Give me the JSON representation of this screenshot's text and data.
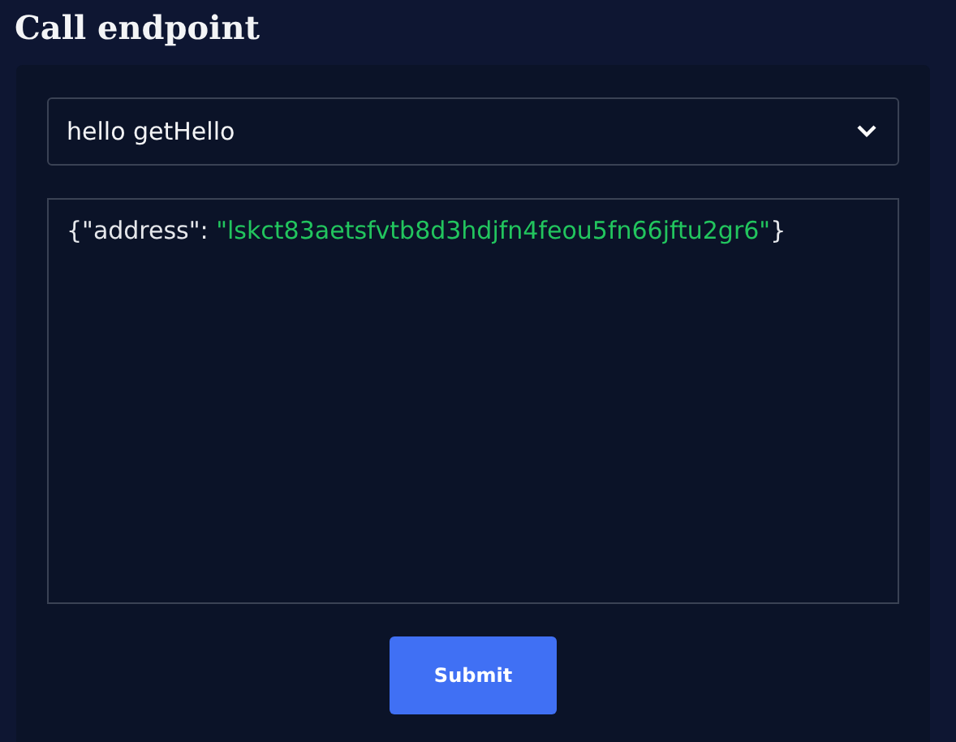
{
  "title": "Call endpoint",
  "endpoint_select": {
    "value": "hello getHello"
  },
  "params_editor": {
    "tokens": [
      {
        "kind": "text",
        "text": "{\"address\": "
      },
      {
        "kind": "string",
        "text": "\"lskct83aetsfvtb8d3hdjfn4feou5fn66jftu2gr6\""
      },
      {
        "kind": "text",
        "text": "}"
      }
    ]
  },
  "submit_button": {
    "label": "Submit"
  }
}
